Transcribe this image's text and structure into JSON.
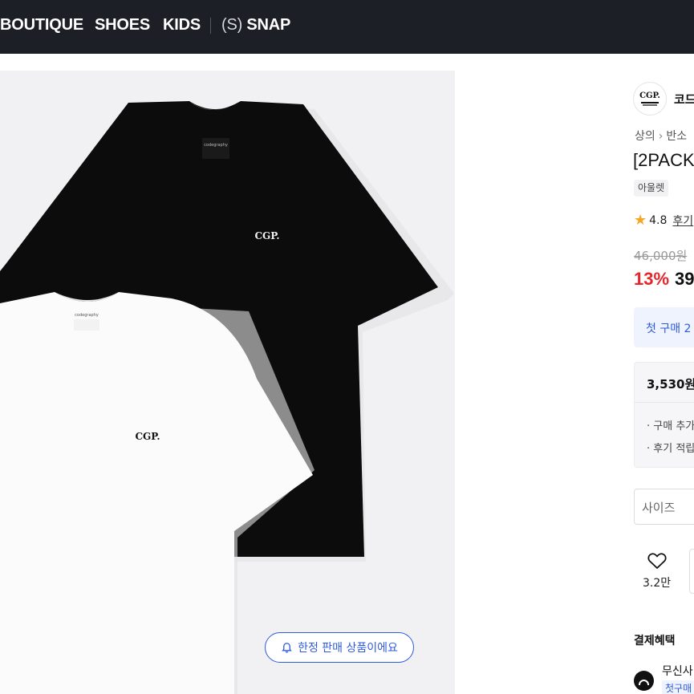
{
  "nav": {
    "items": [
      "BOUTIQUE",
      "SHOES",
      "KIDS"
    ],
    "snap_prefix": "(S)",
    "snap_label": "SNAP"
  },
  "image": {
    "limited_notice": "한정 판매 상품이에요",
    "black_tee_logo": "CGP.",
    "white_tee_logo": "CGP.",
    "neck_label": "codegraphy"
  },
  "product": {
    "brand_logo_text": "CGP.",
    "brand_name": "코드",
    "breadcrumb": [
      "상의",
      "반소"
    ],
    "title": "[2PACK",
    "tag": "아울렛",
    "rating": "4.8",
    "reviews_label": "후기",
    "original_price": "46,000원",
    "discount": "13%",
    "sale_price": "39",
    "coupon_text": "첫 구매 2",
    "points_amount": "3,530원",
    "points_line1": "· 구매 추가",
    "points_line2": "· 후기 적립",
    "size_placeholder": "사이즈",
    "like_count": "3.2만",
    "benefits_title": "결제혜택",
    "pay_name": "무신사",
    "pay_sub": "첫구매"
  },
  "colors": {
    "nav_bg": "#1c1f26",
    "accent_blue": "#2f5bdb",
    "discount_red": "#e4262b",
    "star": "#f5a623",
    "image_bg": "#f1f1f3"
  }
}
